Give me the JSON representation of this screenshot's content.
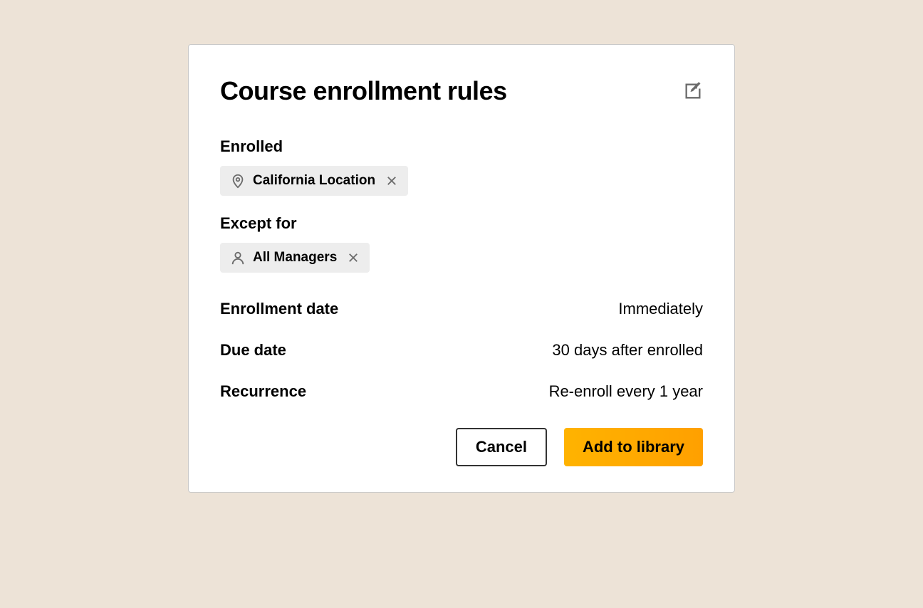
{
  "title": "Course enrollment rules",
  "sections": {
    "enrolled": {
      "label": "Enrolled",
      "chip": {
        "label": "California Location",
        "icon": "location"
      }
    },
    "except": {
      "label": "Except for",
      "chip": {
        "label": "All Managers",
        "icon": "person"
      }
    }
  },
  "rows": {
    "enrollment_date": {
      "label": "Enrollment date",
      "value": "Immediately"
    },
    "due_date": {
      "label": "Due date",
      "value": "30 days after enrolled"
    },
    "recurrence": {
      "label": "Recurrence",
      "value": "Re-enroll every 1 year"
    }
  },
  "actions": {
    "cancel": "Cancel",
    "submit": "Add to library"
  }
}
